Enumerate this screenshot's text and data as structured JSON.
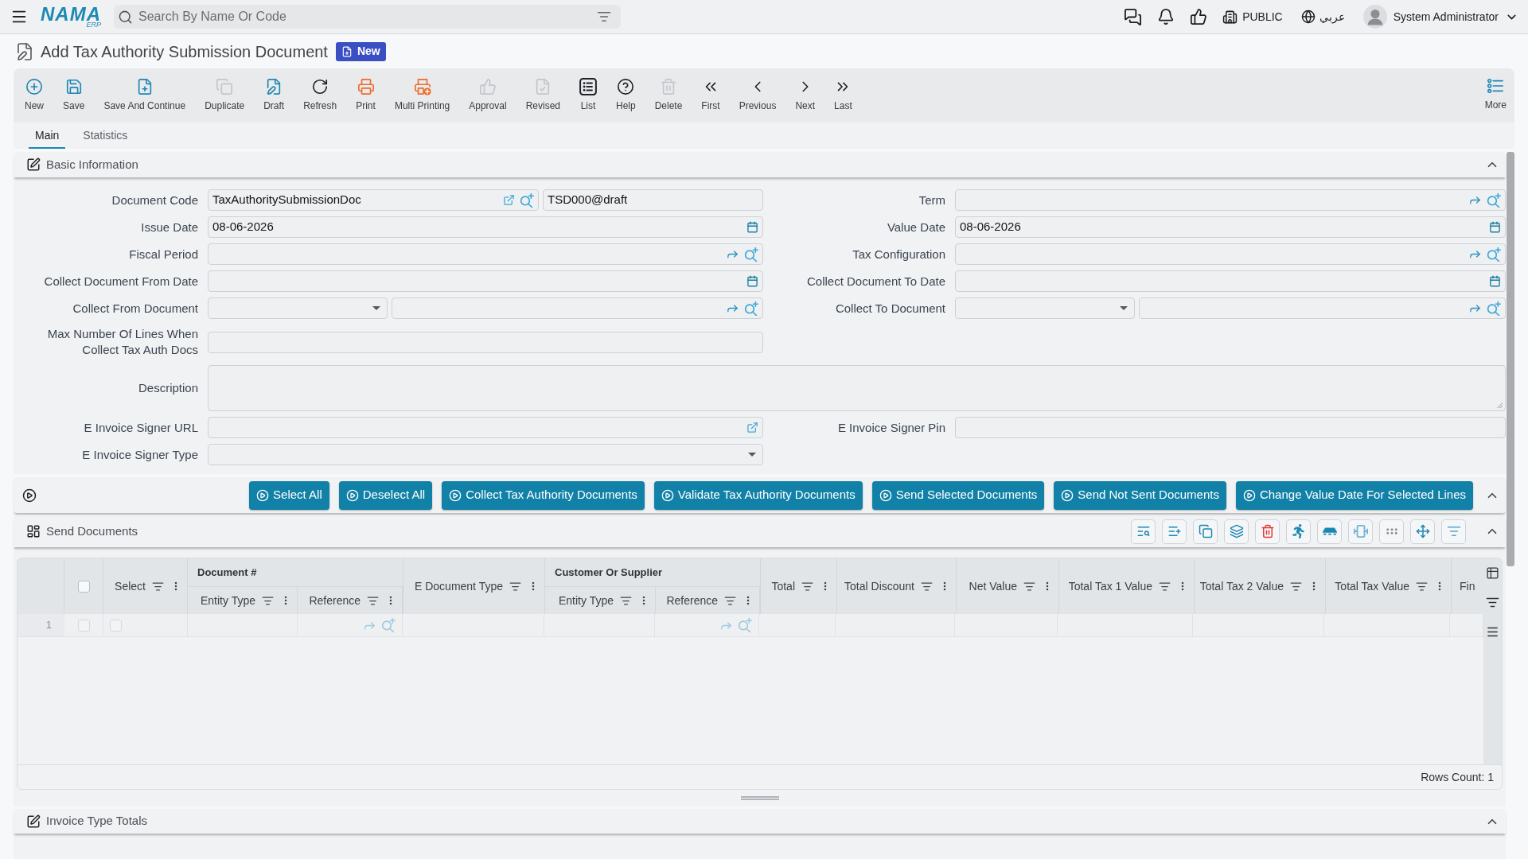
{
  "top_bar": {
    "logo": {
      "name": "NAMA",
      "suffix": "ERP"
    },
    "search": {
      "placeholder": "Search By Name Or Code"
    },
    "company": "PUBLIC",
    "language": "عربي",
    "user": "System Administrator"
  },
  "page": {
    "title": "Add Tax Authority Submission Document",
    "badge": "New"
  },
  "toolbar": {
    "items": [
      {
        "label": "New",
        "kind": "new",
        "disabled": false
      },
      {
        "label": "Save",
        "kind": "save",
        "disabled": false
      },
      {
        "label": "Save And Continue",
        "kind": "save_continue",
        "disabled": false
      },
      {
        "label": "Duplicate",
        "kind": "duplicate",
        "disabled": true
      },
      {
        "label": "Draft",
        "kind": "draft",
        "disabled": false
      },
      {
        "label": "Refresh",
        "kind": "refresh",
        "disabled": false
      },
      {
        "label": "Print",
        "kind": "print",
        "disabled": false
      },
      {
        "label": "Multi Printing",
        "kind": "multi_print",
        "disabled": false
      },
      {
        "label": "Approval",
        "kind": "approval",
        "disabled": true
      },
      {
        "label": "Revised",
        "kind": "revised",
        "disabled": true
      },
      {
        "label": "List",
        "kind": "list",
        "disabled": false
      },
      {
        "label": "Help",
        "kind": "help",
        "disabled": false
      },
      {
        "label": "Delete",
        "kind": "delete",
        "disabled": true
      },
      {
        "label": "First",
        "kind": "first",
        "disabled": false
      },
      {
        "label": "Previous",
        "kind": "previous",
        "disabled": false
      },
      {
        "label": "Next",
        "kind": "next",
        "disabled": false
      },
      {
        "label": "Last",
        "kind": "last",
        "disabled": false
      }
    ],
    "more": "More"
  },
  "tabs": [
    {
      "label": "Main",
      "selected": true
    },
    {
      "label": "Statistics",
      "selected": false
    }
  ],
  "basic_information": {
    "title": "Basic Information",
    "expanded": true,
    "rows": [
      {
        "left": {
          "label": "Document Code",
          "kind": "code",
          "value": "TaxAuthoritySubmissionDoc",
          "serial": "TSD000@draft"
        },
        "right": {
          "label": "Term",
          "kind": "lookup"
        }
      },
      {
        "left": {
          "label": "Issue Date",
          "kind": "date",
          "value": "08-06-2026"
        },
        "right": {
          "label": "Value Date",
          "kind": "date",
          "value": "08-06-2026"
        }
      },
      {
        "left": {
          "label": "Fiscal Period",
          "kind": "lookup"
        },
        "right": {
          "label": "Tax Configuration",
          "kind": "lookup"
        }
      },
      {
        "left": {
          "label": "Collect Document From Date",
          "kind": "date"
        },
        "right": {
          "label": "Collect Document To Date",
          "kind": "date"
        }
      },
      {
        "left": {
          "label": "Collect From Document",
          "kind": "select_lookup"
        },
        "right": {
          "label": "Collect To Document",
          "kind": "select_lookup"
        }
      },
      {
        "left": {
          "label": "Max Number Of Lines When Collect Tax Auth Docs",
          "kind": "text"
        }
      },
      {
        "wide": {
          "label": "Description",
          "kind": "textarea"
        }
      },
      {
        "left": {
          "label": "E Invoice Signer URL",
          "kind": "link"
        },
        "right": {
          "label": "E Invoice Signer Pin",
          "kind": "text"
        }
      },
      {
        "left": {
          "label": "E Invoice Signer Type",
          "kind": "select"
        }
      }
    ]
  },
  "actions": {
    "expanded": true,
    "buttons": [
      "Select All",
      "Deselect All",
      "Collect Tax Authority Documents",
      "Validate Tax Authority Documents",
      "Send Selected Documents",
      "Send Not Sent Documents",
      "Change Value Date For Selected Lines"
    ]
  },
  "send_documents": {
    "title": "Send Documents",
    "expanded": true,
    "all_checked": false,
    "columns": [
      {
        "label": "Select",
        "kind": "checkbox"
      },
      {
        "label": "Document #",
        "children": [
          {
            "label": "Entity Type",
            "kind": "text"
          },
          {
            "label": "Reference",
            "kind": "lookup"
          }
        ]
      },
      {
        "label": "E Document Type",
        "kind": "text"
      },
      {
        "label": "Customer Or Supplier",
        "children": [
          {
            "label": "Entity Type",
            "kind": "text"
          },
          {
            "label": "Reference",
            "kind": "lookup"
          }
        ]
      },
      {
        "label": "Total",
        "kind": "text"
      },
      {
        "label": "Total Discount",
        "kind": "text"
      },
      {
        "label": "Net Value",
        "kind": "text"
      },
      {
        "label": "Total Tax 1 Value",
        "kind": "text"
      },
      {
        "label": "Total Tax 2 Value",
        "kind": "text"
      },
      {
        "label": "Total Tax Value",
        "kind": "text"
      },
      {
        "label": "Fin",
        "kind": "text"
      }
    ],
    "rows": [
      {
        "number": "1",
        "checked": false,
        "select": false
      }
    ],
    "rows_count": "Rows Count: 1"
  },
  "invoice_type_totals": {
    "title": "Invoice Type Totals",
    "expanded": true
  }
}
